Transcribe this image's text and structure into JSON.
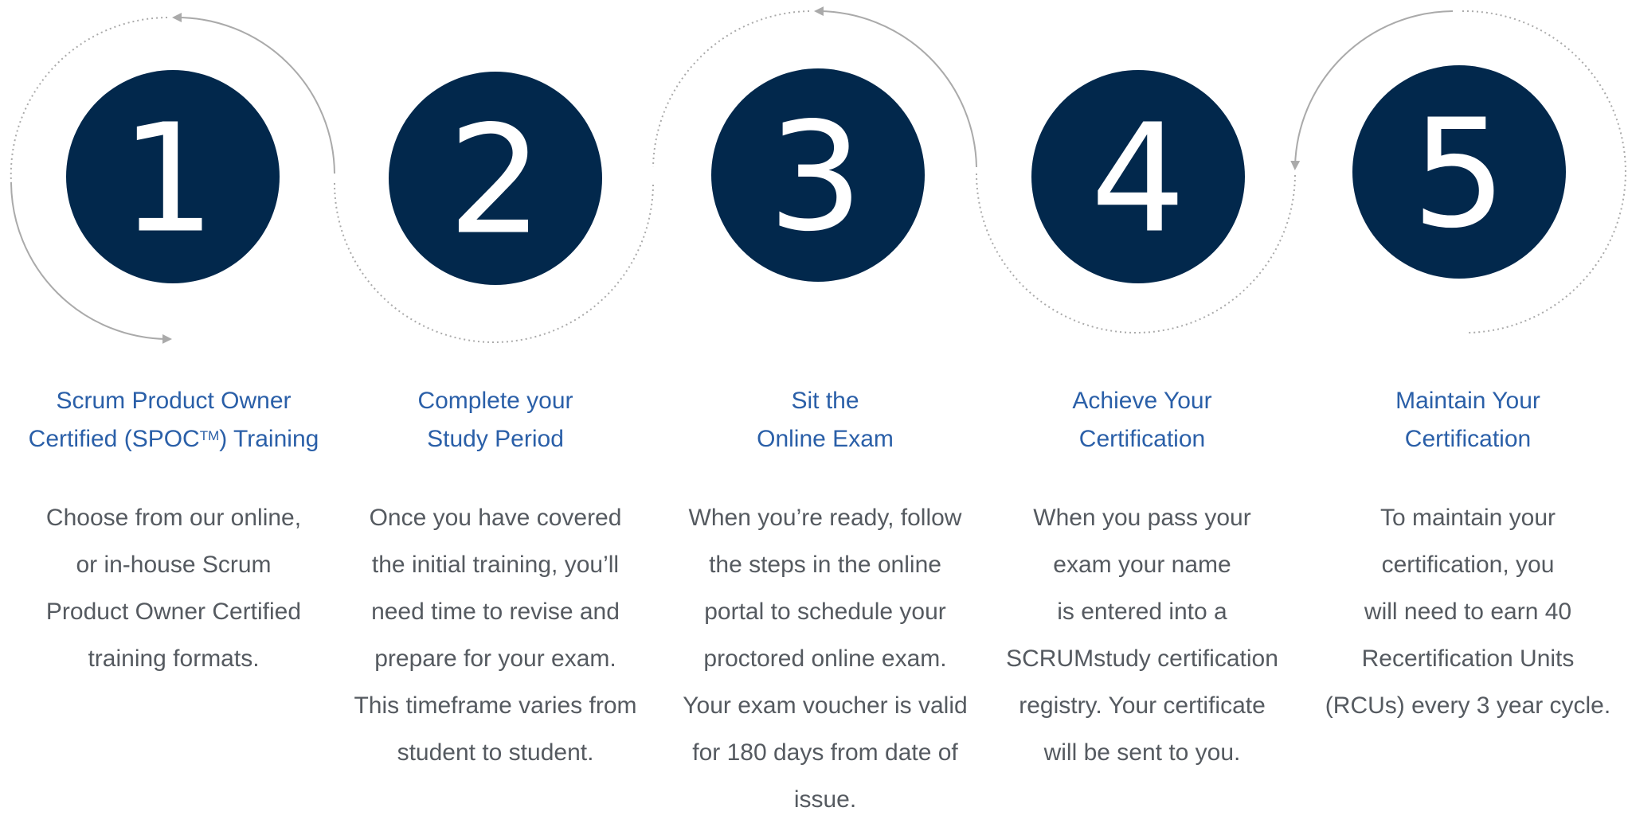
{
  "colors": {
    "circle_fill": "#02284c",
    "number_text": "#ffffff",
    "title_text": "#2a5fa8",
    "body_text": "#555a60",
    "arc_stroke": "#aaaaaa"
  },
  "steps": [
    {
      "number": "1",
      "title_lines": [
        "Scrum Product Owner",
        "Certified (SPOC",
        "TM",
        ") Training"
      ],
      "description_lines": [
        "Choose from our online,",
        "or in-house Scrum",
        "Product Owner Certified",
        "training formats."
      ]
    },
    {
      "number": "2",
      "title_lines": [
        "Complete your",
        "Study Period"
      ],
      "description_lines": [
        "Once you have covered",
        "the initial training, you’ll",
        "need time to revise and",
        "prepare for your exam.",
        "This timeframe varies from",
        "student to student."
      ]
    },
    {
      "number": "3",
      "title_lines": [
        "Sit the",
        "Online Exam"
      ],
      "description_lines": [
        "When you’re ready, follow",
        "the steps in the online",
        "portal to schedule your",
        "proctored online exam.",
        "Your exam voucher is valid",
        "for 180 days from date of",
        "issue."
      ]
    },
    {
      "number": "4",
      "title_lines": [
        "Achieve Your",
        "Certification"
      ],
      "description_lines": [
        "When you pass your",
        "exam your name",
        "is entered into a",
        "SCRUMstudy certification",
        "registry. Your certificate",
        "will be sent to you."
      ]
    },
    {
      "number": "5",
      "title_lines": [
        "Maintain Your",
        "Certification"
      ],
      "description_lines": [
        "To maintain your",
        "certification, you",
        "will need to earn 40",
        "Recertification Units",
        "(RCUs) every 3 year cycle."
      ]
    }
  ]
}
